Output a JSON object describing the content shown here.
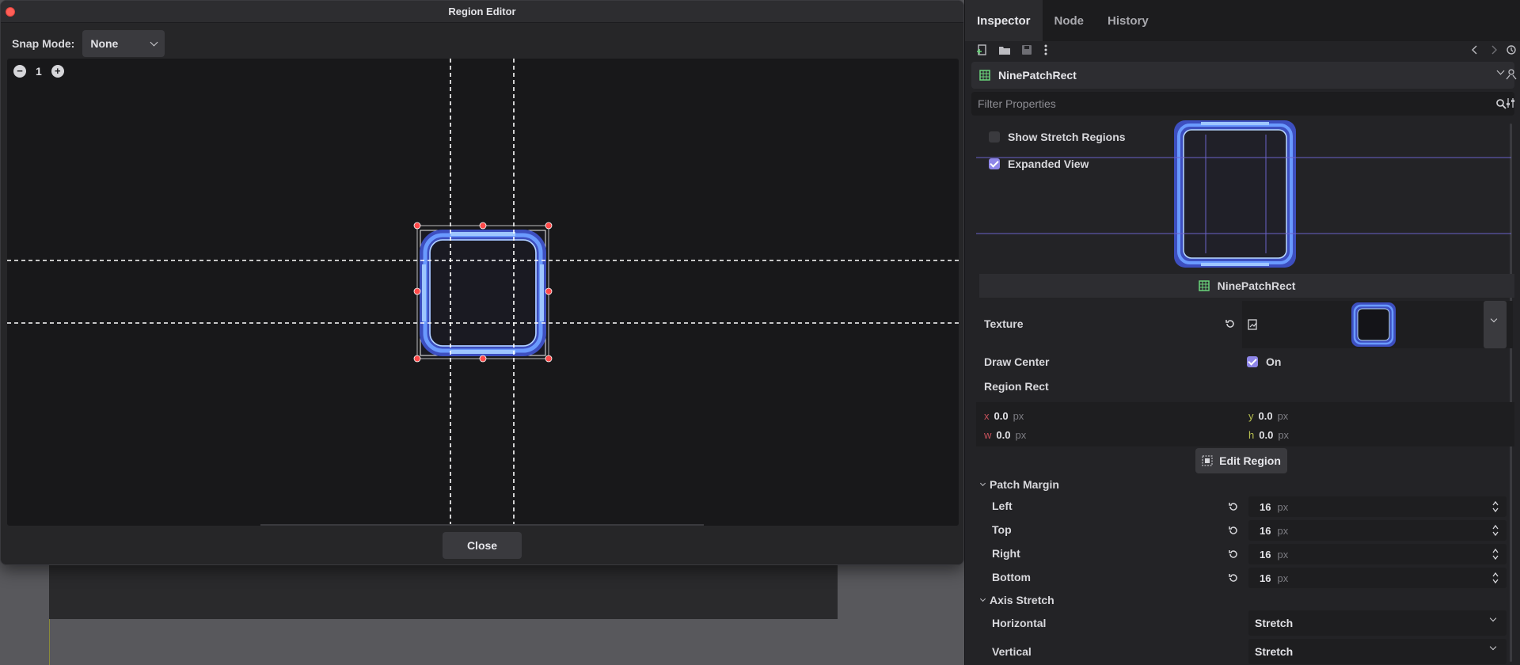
{
  "dialog": {
    "title": "Region Editor",
    "snap_label": "Snap Mode:",
    "snap_value": "None",
    "zoom_level": "1",
    "close_label": "Close"
  },
  "inspector": {
    "tabs": [
      {
        "label": "Inspector",
        "active": true
      },
      {
        "label": "Node",
        "active": false
      },
      {
        "label": "History",
        "active": false
      }
    ],
    "node_name": "NinePatchRect",
    "filter_placeholder": "Filter Properties",
    "show_stretch_regions": {
      "label": "Show Stretch Regions",
      "checked": false
    },
    "expanded_view": {
      "label": "Expanded View",
      "checked": true
    },
    "class_header": "NinePatchRect",
    "texture_label": "Texture",
    "draw_center": {
      "label": "Draw Center",
      "checked": true,
      "value": "On"
    },
    "region_rect": {
      "label": "Region Rect",
      "x": {
        "axis": "x",
        "value": "0.0",
        "unit": "px"
      },
      "y": {
        "axis": "y",
        "value": "0.0",
        "unit": "px"
      },
      "w": {
        "axis": "w",
        "value": "0.0",
        "unit": "px"
      },
      "h": {
        "axis": "h",
        "value": "0.0",
        "unit": "px"
      }
    },
    "edit_region_label": "Edit Region",
    "patch_margin": {
      "label": "Patch Margin",
      "left": {
        "label": "Left",
        "value": "16",
        "unit": "px"
      },
      "top": {
        "label": "Top",
        "value": "16",
        "unit": "px"
      },
      "right": {
        "label": "Right",
        "value": "16",
        "unit": "px"
      },
      "bottom": {
        "label": "Bottom",
        "value": "16",
        "unit": "px"
      }
    },
    "axis_stretch": {
      "label": "Axis Stretch",
      "horizontal": {
        "label": "Horizontal",
        "value": "Stretch"
      },
      "vertical": {
        "label": "Vertical",
        "value": "Stretch"
      }
    }
  },
  "colors": {
    "accent": "#8e86e8",
    "x_axis": "#c4505a",
    "y_axis": "#b8c050",
    "w_axis": "#c4505a",
    "h_axis": "#b8c050",
    "frame_blue": "#4a7ef0",
    "handle_red": "#ff4a4a",
    "node_icon_green": "#6ad47a"
  },
  "icons": [
    "new-script-icon",
    "open-icon",
    "save-icon",
    "more-icon",
    "history-back-icon",
    "history-forward-icon",
    "history-icon",
    "search-icon",
    "filter-settings-icon",
    "reset-icon",
    "texture-file-icon",
    "edit-region-icon",
    "spinner-arrows-icon",
    "zoom-out-icon",
    "zoom-in-icon",
    "chevron-down-icon",
    "ninepatch-node-icon"
  ]
}
